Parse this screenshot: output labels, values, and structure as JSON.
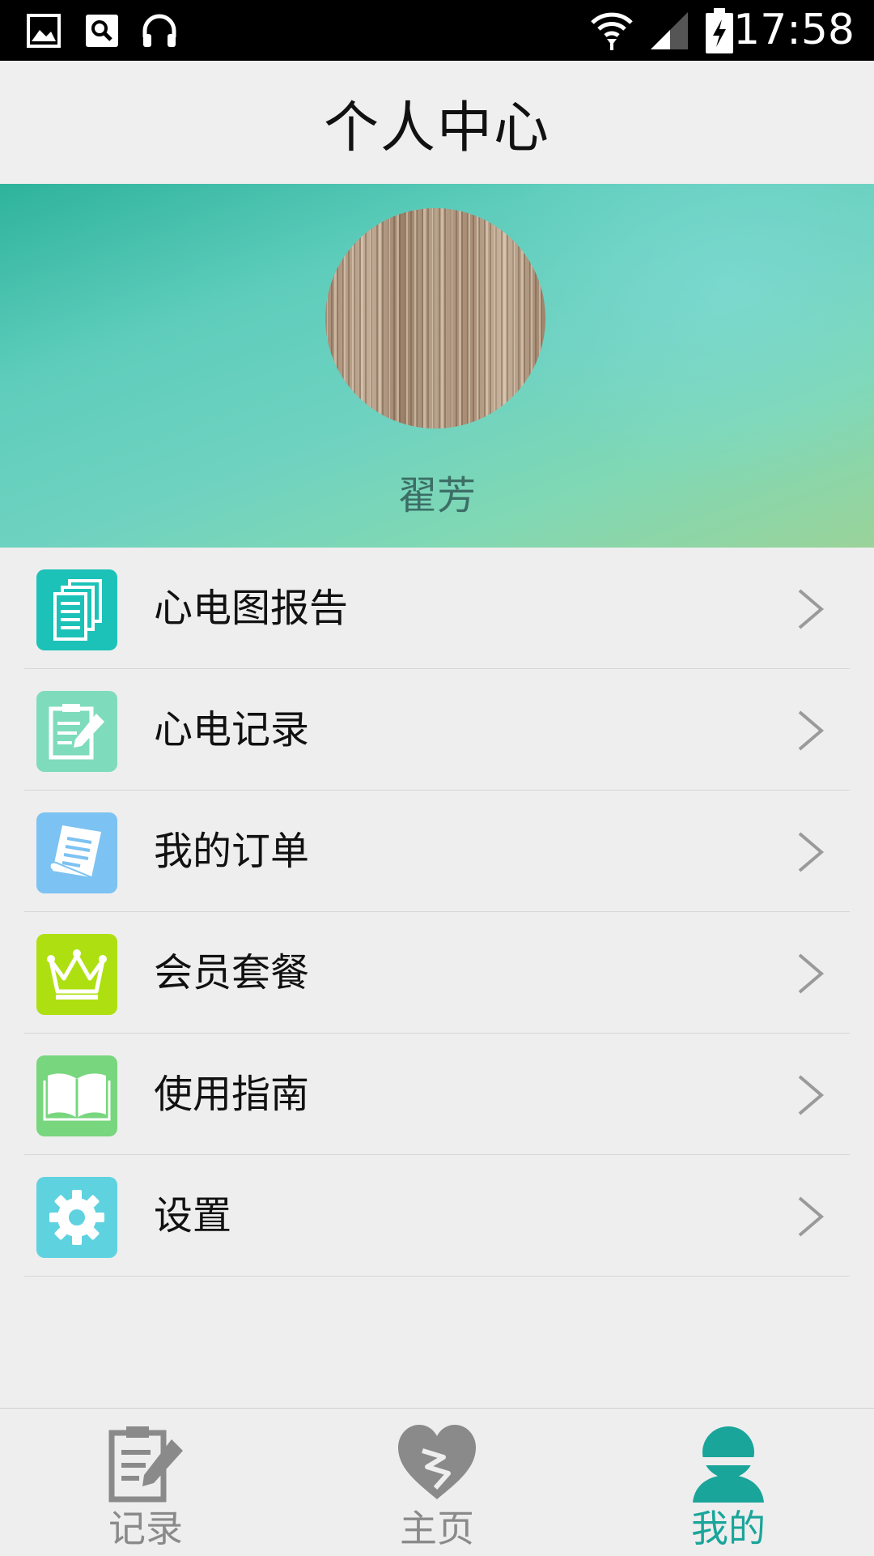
{
  "status_bar": {
    "time": "17:58",
    "icons": [
      "gallery-icon",
      "search-app-icon",
      "headphones-icon",
      "wifi-icon",
      "signal-icon",
      "battery-charging-icon"
    ]
  },
  "header": {
    "title": "个人中心"
  },
  "profile": {
    "name": "翟芳",
    "avatar": "wood-texture-avatar"
  },
  "menu": {
    "items": [
      {
        "label": "心电图报告",
        "icon": "documents-icon",
        "color": "#1cc2b8"
      },
      {
        "label": "心电记录",
        "icon": "clipboard-edit-icon",
        "color": "#7edcbc"
      },
      {
        "label": "我的订单",
        "icon": "receipt-icon",
        "color": "#7cc2f2"
      },
      {
        "label": "会员套餐",
        "icon": "crown-icon",
        "color": "#aee011"
      },
      {
        "label": "使用指南",
        "icon": "book-icon",
        "color": "#78d67e"
      },
      {
        "label": "设置",
        "icon": "gear-icon",
        "color": "#5fd2e0"
      }
    ]
  },
  "tabs": [
    {
      "label": "记录",
      "icon": "clipboard-edit-icon",
      "active": false
    },
    {
      "label": "主页",
      "icon": "broken-heart-icon",
      "active": false
    },
    {
      "label": "我的",
      "icon": "user-icon",
      "active": true
    }
  ],
  "colors": {
    "accent": "#1aa59a",
    "inactive": "#8a8a8a"
  }
}
